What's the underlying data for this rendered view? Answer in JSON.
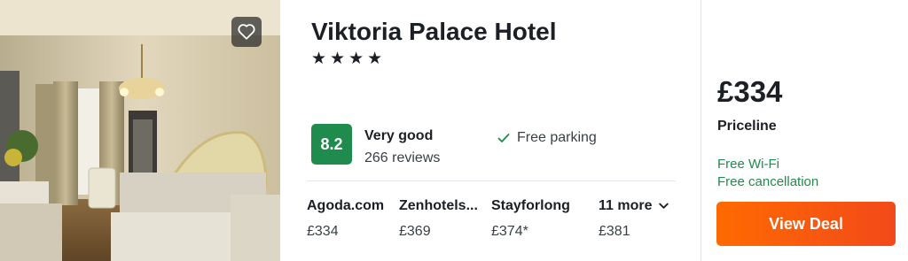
{
  "colors": {
    "score_badge": "#1f8b4c",
    "perk_text": "#1f8b4c",
    "deal_button_start": "#ff6a00",
    "deal_button_end": "#f24a1a"
  },
  "photo": {
    "favorite_icon": "heart-icon"
  },
  "hotel": {
    "name": "Viktoria Palace Hotel",
    "stars_text": "★★★★",
    "star_count": 4,
    "score": "8.2",
    "rating_label": "Very good",
    "reviews": "266 reviews",
    "amenity": "Free parking",
    "amenity_icon": "check-icon"
  },
  "providers": [
    {
      "name": "Agoda.com",
      "price": "£334"
    },
    {
      "name": "Zenhotels...",
      "price": "£369"
    },
    {
      "name": "Stayforlong",
      "price": "£374*"
    },
    {
      "name": "11 more",
      "price": "£381",
      "icon": "chevron-down-icon"
    }
  ],
  "deal": {
    "price": "£334",
    "source": "Priceline",
    "perks": [
      "Free Wi-Fi",
      "Free cancellation"
    ],
    "button_label": "View Deal"
  }
}
